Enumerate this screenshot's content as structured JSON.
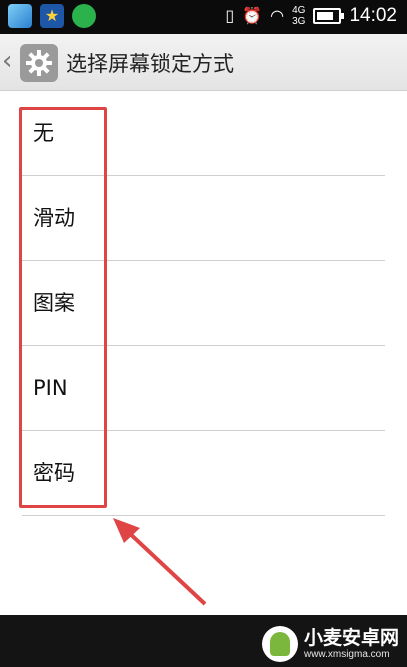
{
  "status_bar": {
    "network_top": "4G",
    "network_bottom": "3G",
    "time": "14:02"
  },
  "header": {
    "title": "选择屏幕锁定方式"
  },
  "list": {
    "items": [
      {
        "label": "无"
      },
      {
        "label": "滑动"
      },
      {
        "label": "图案"
      },
      {
        "label": "PIN"
      },
      {
        "label": "密码"
      }
    ]
  },
  "watermark": {
    "main": "小麦安卓网",
    "sub": "www.xmsigma.com"
  },
  "colors": {
    "annotation": "#e04545",
    "action_bar": "#ececec"
  }
}
